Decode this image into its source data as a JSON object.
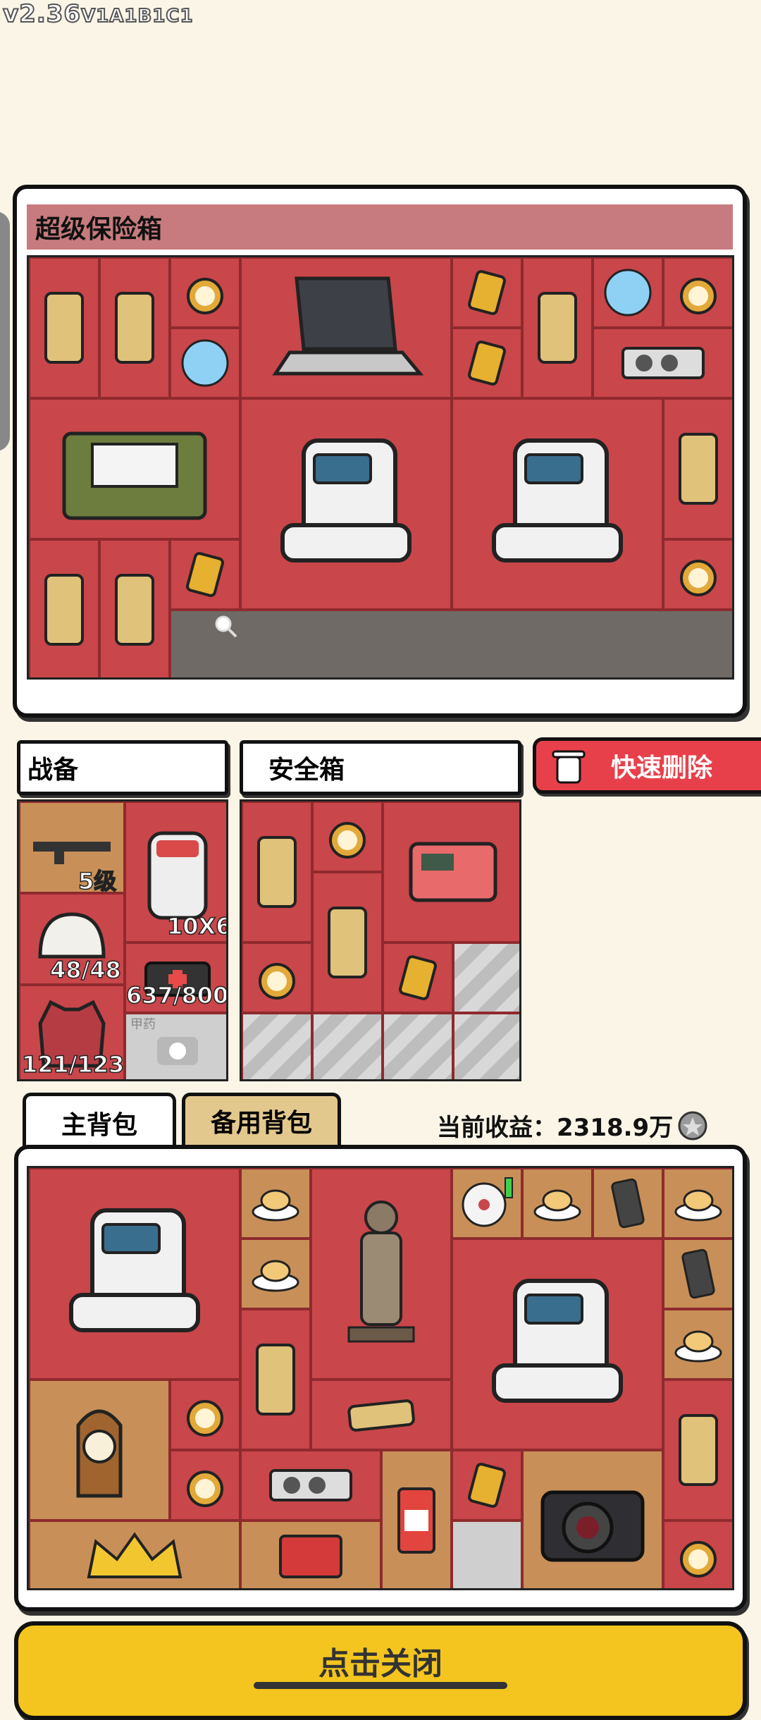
{
  "version": "v2.36",
  "build": "V1A1B1C1",
  "safe_box": {
    "title": "超级保险箱"
  },
  "equipment": {
    "title": "战备",
    "weapon_level": "5级",
    "backpack_size": "10X6",
    "helmet": "48/48",
    "medkit": "637/800",
    "armor": "121/123",
    "armor_slot": "甲药"
  },
  "secure_box": {
    "title": "安全箱"
  },
  "quick_delete": {
    "label": "快速删除"
  },
  "tabs": {
    "main": "主背包",
    "backup": "备用背包"
  },
  "earnings": {
    "label": "当前收益：",
    "value": "2318.9万"
  },
  "close_button": "点击关闭"
}
